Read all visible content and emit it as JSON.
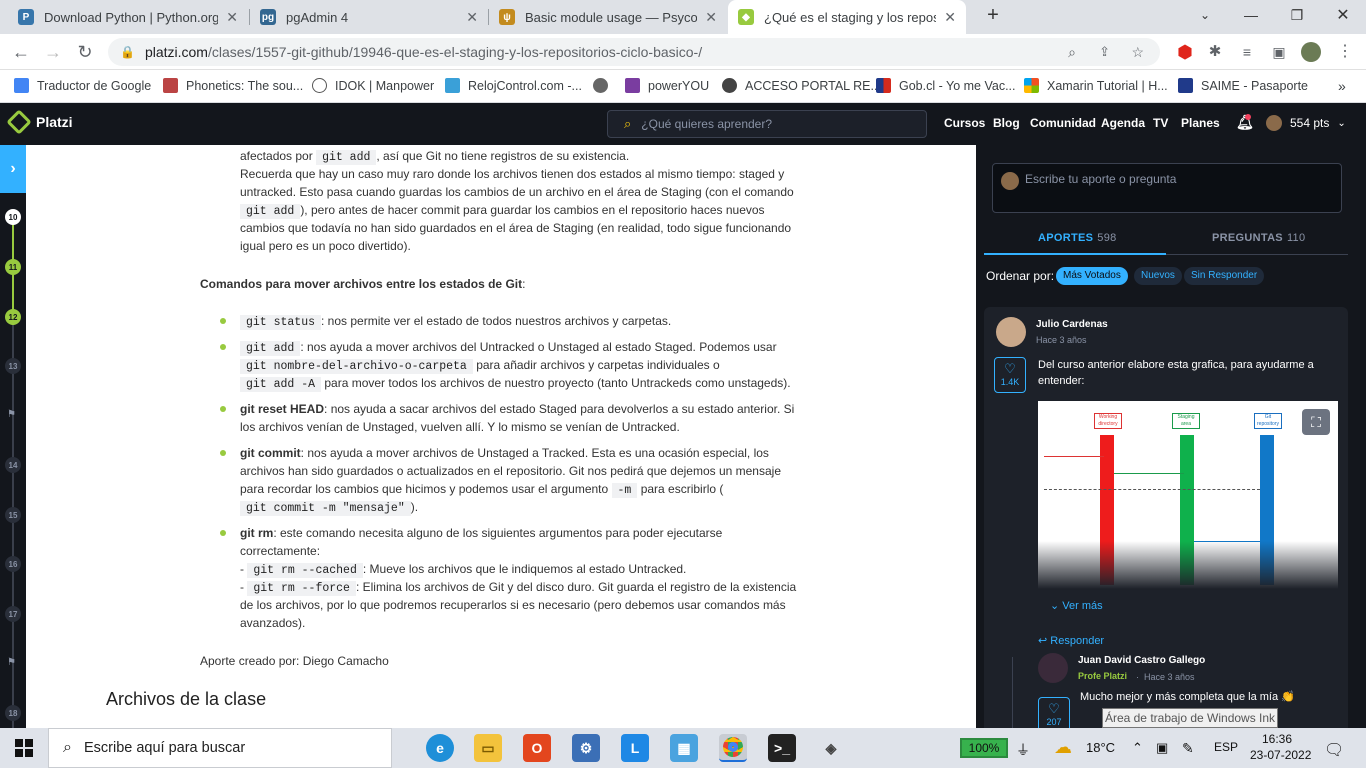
{
  "tabs": [
    {
      "title": "Download Python | Python.org",
      "color": "#3776ab",
      "glyph": "py"
    },
    {
      "title": "pgAdmin 4",
      "color": "#336791",
      "glyph": "pg"
    },
    {
      "title": "Basic module usage — Psycopg",
      "color": "#c38b1e",
      "glyph": "ps"
    },
    {
      "title": "¿Qué es el staging y los reposito",
      "color": "#98ca3f",
      "glyph": "pl"
    }
  ],
  "url": {
    "host": "platzi.com",
    "path": "/clases/1557-git-github/19946-que-es-el-staging-y-los-repositorios-ciclo-basico-/"
  },
  "bookmarks": [
    {
      "label": "Traductor de Google",
      "color": "#4285f4"
    },
    {
      "label": "Phonetics: The sou...",
      "color": "#b44"
    },
    {
      "label": "IDOK | Manpower",
      "color": "#555"
    },
    {
      "label": "RelojControl.com -...",
      "color": "#3aa0d8"
    },
    {
      "label": "",
      "color": "#666"
    },
    {
      "label": "powerYOU",
      "color": "#7a3da0"
    },
    {
      "label": "ACCESO PORTAL RE...",
      "color": "#444"
    },
    {
      "label": "Gob.cl - Yo me Vac...",
      "color": "#d52b1e"
    },
    {
      "label": "Xamarin Tutorial | H...",
      "color": "#f25022"
    },
    {
      "label": "SAIME - Pasaporte",
      "color": "#203a8a"
    }
  ],
  "header": {
    "logo": "Platzi",
    "search_placeholder": "¿Qué quieres aprender?",
    "menu": [
      "Cursos",
      "Blog",
      "Comunidad",
      "Agenda",
      "TV",
      "Planes"
    ],
    "points": "554 pts"
  },
  "rail": {
    "steps": [
      "10",
      "11",
      "12",
      "13",
      "14",
      "15",
      "16",
      "17",
      "18"
    ]
  },
  "article": {
    "l1_pre": "afectados por ",
    "l1_code": "git add",
    "l1_post": ", así que Git no tiene registros de su existencia.",
    "l2": "Recuerda que hay un caso muy raro donde los archivos tienen dos estados al mismo tiempo: staged y",
    "l3": "untracked. Esto pasa cuando guardas los cambios de un archivo en el área de Staging (con el comando",
    "l4_code": "git add",
    "l4_post": "), pero antes de hacer commit para guardar los cambios en el repositorio haces nuevos",
    "l5": "cambios que todavía no han sido guardados en el área de Staging (en realidad, todo sigue funcionando",
    "l6": "igual pero es un poco divertido).",
    "heading": "Comandos para mover archivos entre los estados de Git",
    "colon": ":",
    "b1_code": "git status",
    "b1": ": nos permite ver el estado de todos nuestros archivos y carpetas.",
    "b2_code": "git add",
    "b2": ": nos ayuda a mover archivos del Untracked o Unstaged al estado Staged. Podemos usar",
    "b2_code2": "git nombre-del-archivo-o-carpeta",
    "b2_b": "para añadir archivos y carpetas individuales o",
    "b2_code3": "git add -A",
    "b2_c": "para mover todos los archivos de nuestro proyecto (tanto Untrackeds como unstageds).",
    "b3_bold": "git reset HEAD",
    "b3": ": nos ayuda a sacar archivos del estado Staged para devolverlos a su estado anterior. Si",
    "b3_b": "los archivos venían de Unstaged, vuelven allí. Y lo mismo se venían de Untracked.",
    "b4_bold": "git commit",
    "b4": ": nos ayuda a mover archivos de Unstaged a Tracked. Esta es una ocasión especial, los",
    "b4_b": "archivos han sido guardados o actualizados en el repositorio. Git nos pedirá que dejemos un mensaje",
    "b4_c": "para recordar los cambios que hicimos y podemos usar el argumento",
    "b4_code": "-m",
    "b4_d": "para escribirlo (",
    "b4_code2": "git commit -m \"mensaje\"",
    "b4_e": ").",
    "b5_bold": "git rm",
    "b5": ": este comando necesita alguno de los siguientes argumentos para poder ejecutarse",
    "b5_b": "correctamente:",
    "b5_dash": "-",
    "b5_code1": "git rm --cached",
    "b5_c": ": Mueve los archivos que le indiquemos al estado Untracked.",
    "b5_code2": "git rm --force",
    "b5_d": ": Elimina los archivos de Git y del disco duro. Git guarda el registro de la existencia",
    "b5_e": "de los archivos, por lo que podremos recuperarlos si es necesario (pero debemos usar comandos más",
    "b5_f": "avanzados).",
    "author": "Aporte creado por: Diego Camacho",
    "files_heading": "Archivos de la clase"
  },
  "sidebar": {
    "ask_placeholder": "Escribe tu aporte o pregunta",
    "tab_aportes": "APORTES",
    "aportes_count": "598",
    "tab_preguntas": "PREGUNTAS",
    "preguntas_count": "110",
    "order_label": "Ordenar por:",
    "filters": [
      "Más Votados",
      "Nuevos",
      "Sin Responder"
    ],
    "post": {
      "author": "Julio Cardenas",
      "time": "Hace 3 años",
      "likes": "1.4K",
      "text": "Del curso anterior elabore esta grafica, para ayudarme a entender:",
      "see_more": "Ver más",
      "reply": "Responder",
      "image_labels": [
        "Working directory",
        "Staging area",
        "Git repository"
      ],
      "reply_author": "Juan David Castro Gallego",
      "reply_role": "Profe Platzi",
      "reply_sep": "·",
      "reply_time": "Hace 3 años",
      "reply_text": "Mucho mejor y más completa que la mía 👏",
      "reply_likes": "207"
    }
  },
  "tooltip": "Área de trabajo de Windows Ink",
  "taskbar": {
    "search": "Escribe aquí para buscar",
    "battery": "100%",
    "temp": "18°C",
    "lang": "ESP",
    "time": "16:36",
    "date": "23-07-2022"
  }
}
